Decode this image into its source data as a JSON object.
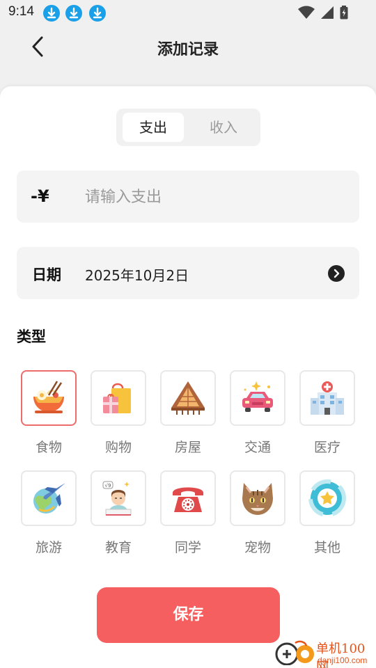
{
  "status_bar": {
    "time": "9:14",
    "download_icons": [
      "download-icon",
      "download-icon",
      "download-icon"
    ],
    "indicators": [
      "wifi-icon",
      "signal-icon",
      "battery-icon"
    ]
  },
  "header": {
    "title": "添加记录",
    "back_icon": "chevron-left-icon"
  },
  "type_toggle": {
    "options": [
      "支出",
      "收入"
    ],
    "selected": "支出"
  },
  "amount": {
    "prefix": "-¥",
    "placeholder": "请输入支出",
    "value": ""
  },
  "date": {
    "label": "日期",
    "value": "2025年10月2日",
    "arrow_icon": "chevron-right-circle-icon"
  },
  "category_section": {
    "title": "类型",
    "selected": "食物",
    "items": [
      {
        "label": "食物",
        "icon": "noodle-bowl-icon"
      },
      {
        "label": "购物",
        "icon": "shopping-bag-icon"
      },
      {
        "label": "房屋",
        "icon": "house-icon"
      },
      {
        "label": "交通",
        "icon": "car-icon"
      },
      {
        "label": "医疗",
        "icon": "hospital-icon"
      },
      {
        "label": "旅游",
        "icon": "airplane-globe-icon"
      },
      {
        "label": "教育",
        "icon": "student-icon"
      },
      {
        "label": "同学",
        "icon": "telephone-icon"
      },
      {
        "label": "宠物",
        "icon": "cat-icon"
      },
      {
        "label": "其他",
        "icon": "star-ring-icon"
      }
    ]
  },
  "save_button": {
    "label": "保存"
  },
  "watermark": {
    "name": "单机100网",
    "url": "danji100.com"
  },
  "colors": {
    "accent": "#f65f5f",
    "selected_border": "#ee6b6b",
    "background": "#f0f0f0",
    "field_background": "#f4f4f4"
  }
}
